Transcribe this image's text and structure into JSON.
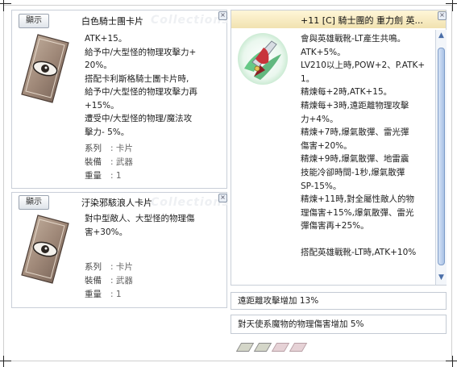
{
  "left_top": {
    "show_label": "顯示",
    "title": "白色騎士團卡片",
    "watermark": "Collections",
    "icon": "eye-card-icon",
    "desc_lines": [
      "ATK+15。",
      "給予中/大型怪的物理攻擊力+",
      "20%。",
      "搭配卡利斯格騎士團卡片時,",
      "給予中/大型怪的物理攻擊力再",
      "+15%。",
      "遭受中/大型怪的物理/魔法攻",
      "擊力- 5%。"
    ],
    "stats": [
      {
        "label": "系列",
        "value": ": 卡片"
      },
      {
        "label": "裝備",
        "value": ": 武器"
      },
      {
        "label": "重量",
        "value": ": 1"
      }
    ]
  },
  "left_bottom": {
    "show_label": "顯示",
    "title": "汙染邪駭浪人卡片",
    "watermark": "Collections",
    "icon": "eye-card-icon",
    "desc_lines": [
      "對中型敵人、大型怪的物理傷",
      "害+30%。"
    ],
    "stats": [
      {
        "label": "系列",
        "value": ": 卡片"
      },
      {
        "label": "裝備",
        "value": ": 武器"
      },
      {
        "label": "重量",
        "value": ": 1"
      }
    ]
  },
  "right": {
    "title": "+11 [C] 騎士團的 重力劍 英...",
    "icon": "sword-icon",
    "desc_lines": [
      "會與英雄戰靴-LT產生共鳴。",
      "ATK+5%。",
      "LV210以上時,POW+2、P.ATK+",
      "1。",
      "精煉每+2時,ATK+15。",
      "精煉每+3時,遠距離物理攻擊",
      "力+4%。",
      "精煉+7時,爆氣散彈、雷光彈",
      "傷害+20%。",
      "精煉+9時,爆氣散彈、地雷震",
      "技能冷卻時間-1秒,爆氣散彈",
      "SP-15%。",
      "精煉+11時,對全屬性敵人的物",
      "理傷害+15%,爆氣散彈、雷光",
      "彈傷害再+25%。",
      "",
      "搭配英雄戰靴-LT時,ATK+10%"
    ],
    "option1": "遠距離攻擊增加 13%",
    "option2": "對天使系魔物的物理傷害增加  5%",
    "scroll_up": "▲",
    "scroll_down": "▼"
  },
  "close_glyph": "×"
}
